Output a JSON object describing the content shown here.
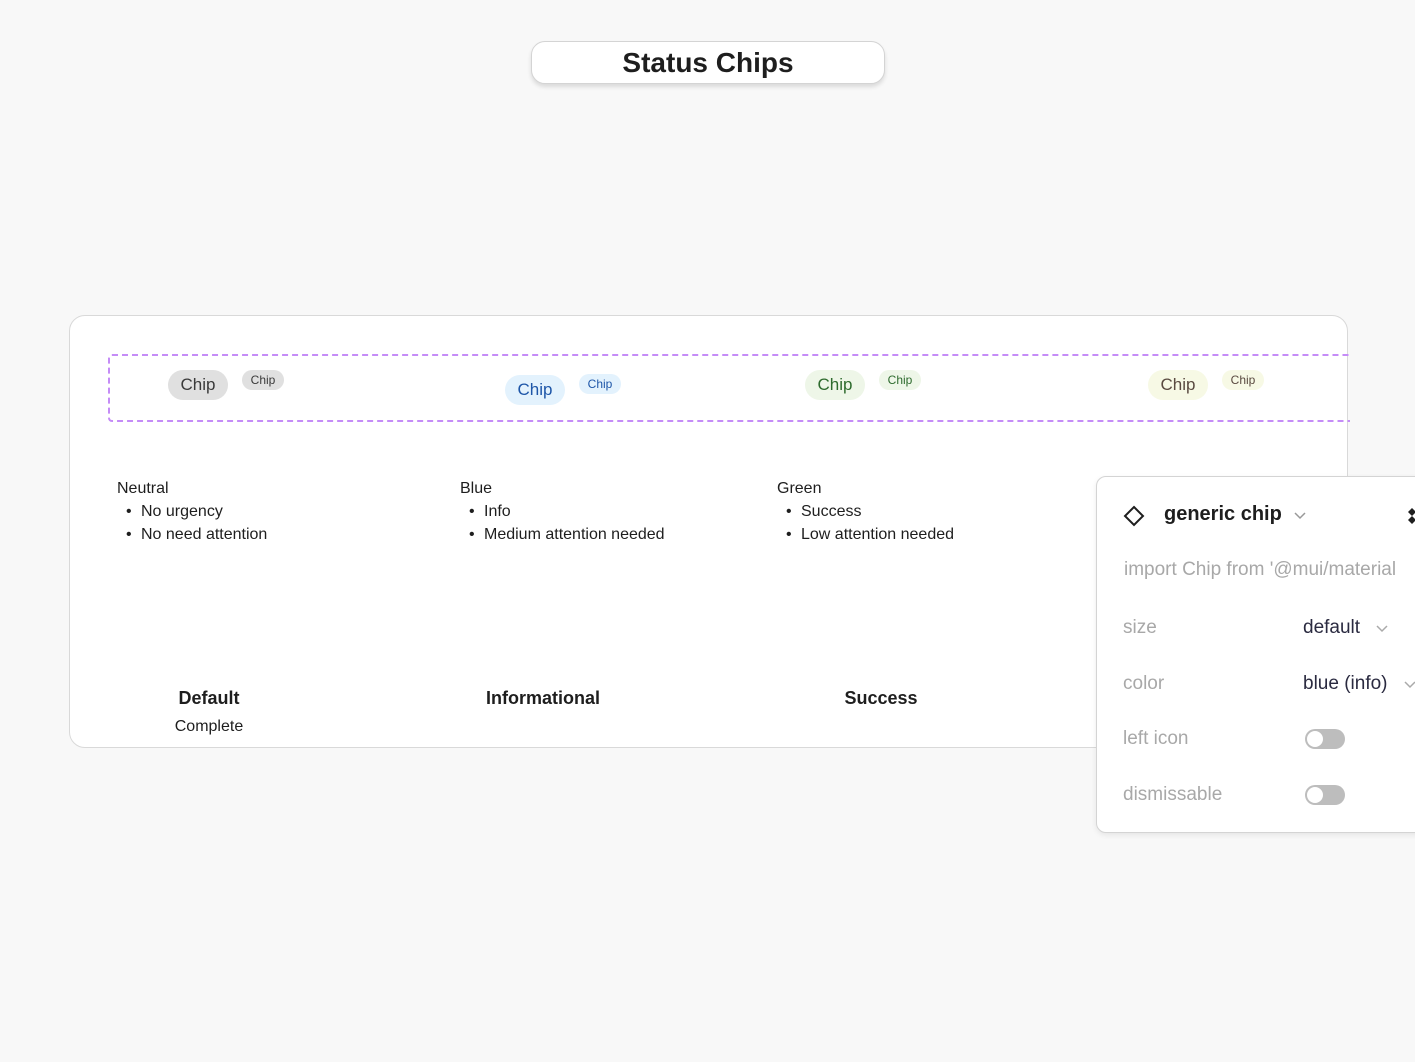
{
  "title": "Status Chips",
  "chips": [
    {
      "label": "Chip",
      "small_label": "Chip",
      "bg": "#e0e0e0",
      "fg": "#3a3a3a"
    },
    {
      "label": "Chip",
      "small_label": "Chip",
      "bg": "#e3f2fd",
      "fg": "#1e56a8"
    },
    {
      "label": "Chip",
      "small_label": "Chip",
      "bg": "#eef6e8",
      "fg": "#2e6b2e"
    },
    {
      "label": "Chip",
      "small_label": "Chip",
      "bg": "#f7f9e5",
      "fg": "#5a4a40"
    }
  ],
  "descriptions": [
    {
      "name": "Neutral",
      "bullets": [
        "No urgency",
        "No need attention"
      ]
    },
    {
      "name": "Blue",
      "bullets": [
        "Info",
        "Medium attention needed"
      ]
    },
    {
      "name": "Green",
      "bullets": [
        "Success",
        "Low attention needed"
      ]
    }
  ],
  "headings": [
    {
      "title": "Default",
      "subtitle": "Complete"
    },
    {
      "title": "Informational"
    },
    {
      "title": "Success"
    }
  ],
  "panel": {
    "component_name": "generic chip",
    "import_text": "import Chip from '@mui/material",
    "props": [
      {
        "label": "size",
        "value": "default"
      },
      {
        "label": "color",
        "value": "blue (info)"
      },
      {
        "label": "left icon",
        "toggle": false
      },
      {
        "label": "dismissable",
        "toggle": false
      }
    ]
  }
}
